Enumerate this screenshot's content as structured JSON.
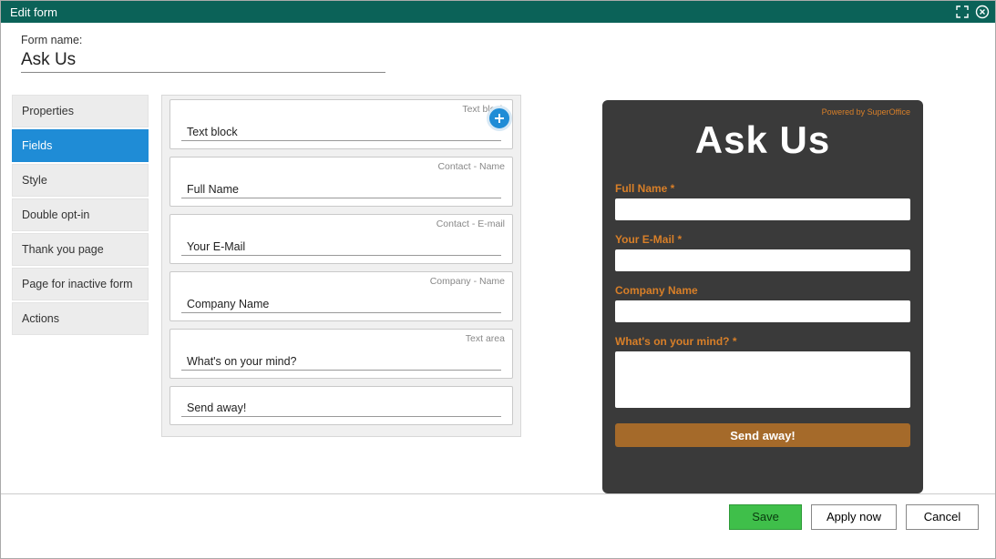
{
  "window": {
    "title": "Edit form"
  },
  "form_name": {
    "label": "Form name:",
    "value": "Ask Us"
  },
  "sidebar": {
    "items": [
      {
        "label": "Properties",
        "active": false
      },
      {
        "label": "Fields",
        "active": true
      },
      {
        "label": "Style",
        "active": false
      },
      {
        "label": "Double opt-in",
        "active": false
      },
      {
        "label": "Thank you page",
        "active": false
      },
      {
        "label": "Page for inactive form",
        "active": false
      },
      {
        "label": "Actions",
        "active": false
      }
    ]
  },
  "fields": [
    {
      "tag": "Text block",
      "label": "Text block"
    },
    {
      "tag": "Contact - Name",
      "label": "Full Name"
    },
    {
      "tag": "Contact - E-mail",
      "label": "Your E-Mail"
    },
    {
      "tag": "Company - Name",
      "label": "Company Name"
    },
    {
      "tag": "Text area",
      "label": "What's on your mind?"
    },
    {
      "tag": "",
      "label": "Send away!"
    }
  ],
  "preview": {
    "powered": "Powered by SuperOffice",
    "title": "Ask Us",
    "fields": [
      {
        "label": "Full Name *",
        "type": "text"
      },
      {
        "label": "Your E-Mail *",
        "type": "text"
      },
      {
        "label": "Company Name",
        "type": "text"
      },
      {
        "label": "What's on your mind? *",
        "type": "textarea"
      }
    ],
    "submit": "Send away!"
  },
  "footer": {
    "save": "Save",
    "apply": "Apply now",
    "cancel": "Cancel"
  }
}
